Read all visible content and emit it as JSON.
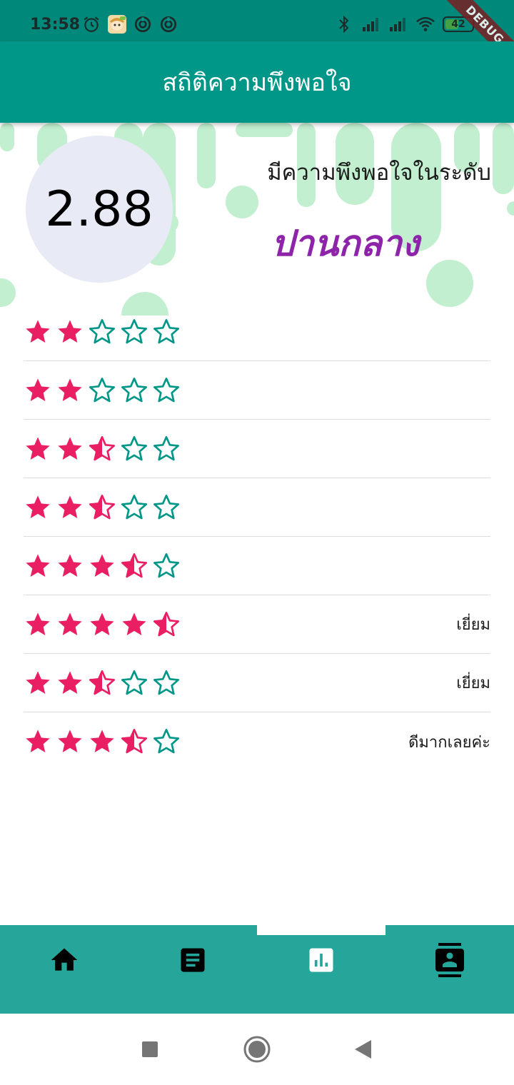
{
  "status_bar": {
    "time": "13:58",
    "battery": "42",
    "left_icons": [
      "alarm-icon",
      "app-avatar-icon",
      "sync-icon",
      "sync-icon"
    ],
    "right_icons": [
      "bluetooth-icon",
      "signal-icon",
      "signal-icon",
      "wifi-icon",
      "battery-icon"
    ]
  },
  "debug_banner": "DEBUG",
  "app_bar": {
    "title": "สถิติความพึงพอใจ"
  },
  "summary": {
    "score": "2.88",
    "label": "มีความพึงพอใจในระดับ",
    "level": "ปานกลาง"
  },
  "colors": {
    "primary": "#009688",
    "star_filled": "#e91e63",
    "star_empty": "#009688",
    "level_text": "#8e24aa",
    "blob": "#c2efd0"
  },
  "ratings": [
    {
      "stars": 2,
      "comment": ""
    },
    {
      "stars": 2,
      "comment": ""
    },
    {
      "stars": 2.5,
      "comment": ""
    },
    {
      "stars": 2.5,
      "comment": ""
    },
    {
      "stars": 3.5,
      "comment": ""
    },
    {
      "stars": 4.5,
      "comment": "เยี่ยม"
    },
    {
      "stars": 2.5,
      "comment": "เยี่ยม"
    },
    {
      "stars": 3.5,
      "comment": "ดีมากเลยค่ะ"
    }
  ],
  "bottom_nav": {
    "items": [
      "home-icon",
      "article-icon",
      "chart-icon",
      "contacts-icon"
    ],
    "selected_index": 2
  },
  "system_nav": [
    "recents-button",
    "home-button",
    "back-button"
  ]
}
